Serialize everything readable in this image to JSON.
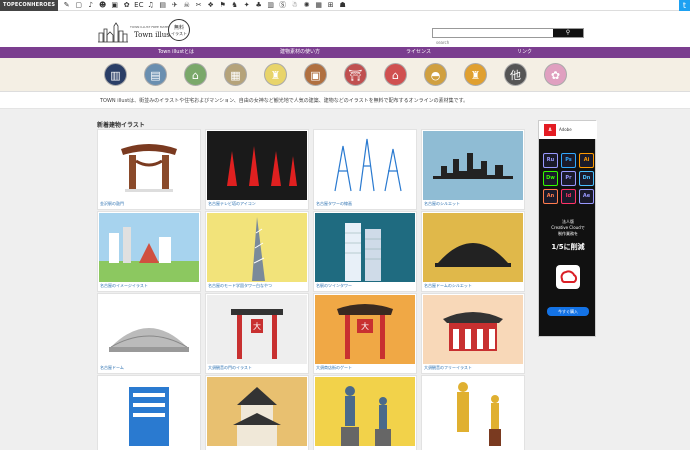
{
  "topbar": {
    "brand": "TOPECONHEROES",
    "icons": [
      "✎",
      "▢",
      "♪",
      "☻",
      "▣",
      "✿",
      "EC",
      "♫",
      "▤",
      "✈",
      "☠",
      "✂",
      "❖",
      "⚑",
      "♞",
      "✦",
      "♣",
      "▥",
      "Ⓢ",
      "☃",
      "✺",
      "▦",
      "⊞",
      "☗"
    ],
    "twitter": "t"
  },
  "logo": {
    "small": "TOWN ILLUST FREE MATERIAL",
    "name": "Town illust",
    "badge_l1": "無料",
    "badge_l2": "イラスト"
  },
  "search": {
    "placeholder": "search",
    "button": "⚲"
  },
  "nav": [
    "Town illustとは",
    "建物素材の使い方",
    "ライセンス",
    "リンク"
  ],
  "categories": [
    {
      "name": "city-icon",
      "color": "#2a3e66",
      "glyph": "▥"
    },
    {
      "name": "building-icon",
      "color": "#6a8fb0",
      "glyph": "▤"
    },
    {
      "name": "house-icon",
      "color": "#7aa86a",
      "glyph": "⌂"
    },
    {
      "name": "apartment-icon",
      "color": "#b5a37a",
      "glyph": "▦"
    },
    {
      "name": "tower-icon",
      "color": "#e8d46a",
      "glyph": "♜"
    },
    {
      "name": "station-icon",
      "color": "#b07040",
      "glyph": "▣"
    },
    {
      "name": "temple-icon",
      "color": "#c05050",
      "glyph": "⛩"
    },
    {
      "name": "shop-icon",
      "color": "#d05050",
      "glyph": "⌂"
    },
    {
      "name": "dome-icon",
      "color": "#d0a040",
      "glyph": "◓"
    },
    {
      "name": "castle-icon",
      "color": "#e0a030",
      "glyph": "♜"
    },
    {
      "name": "other-icon",
      "color": "#555555",
      "glyph": "他"
    },
    {
      "name": "flower-icon",
      "color": "#e0a0c0",
      "glyph": "✿"
    }
  ],
  "intro": "TOWN illustは、街並みのイラストや住宅およびマンション、自由の女神など観光地で人気の建築、建物などのイラストを無料で配布するオンラインの素材集です。",
  "section_title": "新着建物イラスト",
  "cards": [
    {
      "caption": "金沢駅の鼓門",
      "bg": "#ffffff"
    },
    {
      "caption": "名古屋テレビ塔のアイコン",
      "bg": "#1a1a1a"
    },
    {
      "caption": "名古屋タワーの線画",
      "bg": "#ffffff"
    },
    {
      "caption": "名古屋のシルエット",
      "bg": "#8fbcd4"
    },
    {
      "caption": "名古屋のイメージイラスト",
      "bg": "#a7d3ee"
    },
    {
      "caption": "名古屋のモード学園タワー白なやつ",
      "bg": "#f2e37a"
    },
    {
      "caption": "名駅のツインタワー",
      "bg": "#1f6b80"
    },
    {
      "caption": "名古屋ドームのシルエット",
      "bg": "#e0b84a"
    },
    {
      "caption": "名古屋ドーム",
      "bg": "#ffffff"
    },
    {
      "caption": "大須観音の門のイラスト",
      "bg": "#eeeeee"
    },
    {
      "caption": "大須商店街のゲート",
      "bg": "#f0a845"
    },
    {
      "caption": "大須観音のフリーイラスト",
      "bg": "#f8d8b8"
    },
    {
      "caption": "",
      "bg": "#ffffff"
    },
    {
      "caption": "",
      "bg": "#e8c070"
    },
    {
      "caption": "",
      "bg": "#f2d24a"
    },
    {
      "caption": "",
      "bg": "#ffffff"
    }
  ],
  "ad": {
    "brand": "Adobe",
    "apps": [
      {
        "label": "Ru",
        "color": "#9999ff"
      },
      {
        "label": "Ps",
        "color": "#31a8ff"
      },
      {
        "label": "Ai",
        "color": "#ff9a00"
      },
      {
        "label": "Dw",
        "color": "#35fa00"
      },
      {
        "label": "Pr",
        "color": "#9999ff"
      },
      {
        "label": "Dn",
        "color": "#4bc0ff"
      },
      {
        "label": "An",
        "color": "#ff7c4d"
      },
      {
        "label": "Id",
        "color": "#ff3366"
      },
      {
        "label": "Ae",
        "color": "#9999ff"
      }
    ],
    "line1": "法人版",
    "line2": "Creative Cloudで",
    "line3": "制作業務を",
    "headline": "1/5に削減",
    "cta": "今すぐ購入"
  }
}
